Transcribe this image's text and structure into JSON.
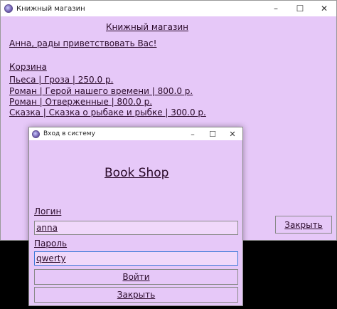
{
  "main_window": {
    "title": "Книжный магазин",
    "controls": {
      "minimize": "–",
      "maximize": "☐",
      "close": "✕"
    },
    "heading": "Книжный магазин",
    "greeting": "Анна, рады приветствовать Вас!",
    "cart_title": "Корзина",
    "cart_items": [
      "Пьеса | Гроза | 250.0 р.",
      "Роман | Герой нашего времени | 800.0 р.",
      "Роман | Отверженные | 800.0 р.",
      "Сказка | Сказка о рыбаке и рыбке | 300.0 р."
    ],
    "close_label": "Закрыть"
  },
  "login_window": {
    "title": "Вход в систему",
    "controls": {
      "minimize": "–",
      "maximize": "☐",
      "close": "✕"
    },
    "shop_title": "Book Shop ",
    "login_label": "Логин",
    "login_value": "anna",
    "password_label": "Пароль",
    "password_value": "qwerty",
    "login_button": "Войти",
    "close_button": "Закрыть"
  },
  "colors": {
    "window_bg": "#e6c8f8",
    "text": "#2a0a2a",
    "focus_border": "#3a78d8"
  }
}
